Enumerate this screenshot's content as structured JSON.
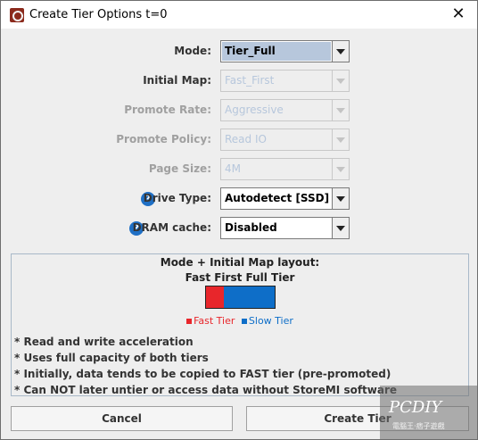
{
  "window": {
    "title": "Create Tier Options t=0",
    "close_glyph": "✕"
  },
  "form": {
    "mode": {
      "label": "Mode:",
      "value": "Tier_Full"
    },
    "initial_map": {
      "label": "Initial Map:",
      "value": "Fast_First"
    },
    "promote_rate": {
      "label": "Promote Rate:",
      "value": "Aggressive"
    },
    "promote_policy": {
      "label": "Promote Policy:",
      "value": "Read IO"
    },
    "page_size": {
      "label": "Page Size:",
      "value": "4M"
    },
    "drive_type": {
      "label": "Drive Type:",
      "value": "Autodetect [SSD]"
    },
    "dram_cache": {
      "label": "DRAM cache:",
      "value": "Disabled"
    }
  },
  "help_glyph": "?",
  "layout_panel": {
    "title": "Mode + Initial Map layout:",
    "subtitle": "Fast First Full Tier",
    "legend_fast": "Fast Tier",
    "legend_slow": "Slow Tier",
    "fast_color": "#e8262b",
    "slow_color": "#0e6ec8",
    "bullets": [
      "* Read and write acceleration",
      "* Uses full capacity of both tiers",
      "* Initially, data tends to be copied to FAST tier (pre-promoted)",
      "* Can NOT later untier or access data without StoreMI software"
    ]
  },
  "buttons": {
    "cancel": "Cancel",
    "create": "Create Tier"
  },
  "watermark": {
    "text": "PCDIY",
    "subtext": "電腦王·痞子遊戲"
  }
}
